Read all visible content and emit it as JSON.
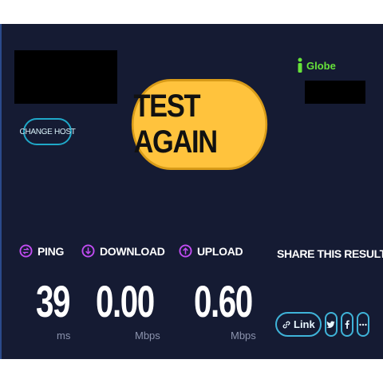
{
  "change_host": {
    "label": "CHANGE HOST"
  },
  "test_again": {
    "label": "TEST AGAIN"
  },
  "isp": {
    "name": "Globe"
  },
  "metrics": {
    "ping": {
      "label": "PING",
      "value": "39",
      "unit": "ms"
    },
    "download": {
      "label": "DOWNLOAD",
      "value": "0.00",
      "unit": "Mbps"
    },
    "upload": {
      "label": "UPLOAD",
      "value": "0.60",
      "unit": "Mbps"
    }
  },
  "share": {
    "title": "SHARE THIS RESULT",
    "link_label": "Link"
  },
  "colors": {
    "background": "#151b33",
    "accent_button": "#ffc33d",
    "ping_icon": "#c24cf3",
    "download_icon": "#c24cf3",
    "upload_icon": "#c24cf3",
    "isp": "#66e33a",
    "outline": "#3fb3d8"
  },
  "icons": {
    "ping": "ping-icon",
    "download": "download-icon",
    "upload": "upload-icon",
    "isp": "isp-person-icon",
    "link": "link-icon",
    "twitter": "twitter-icon",
    "facebook": "facebook-icon",
    "more": "more-icon"
  }
}
